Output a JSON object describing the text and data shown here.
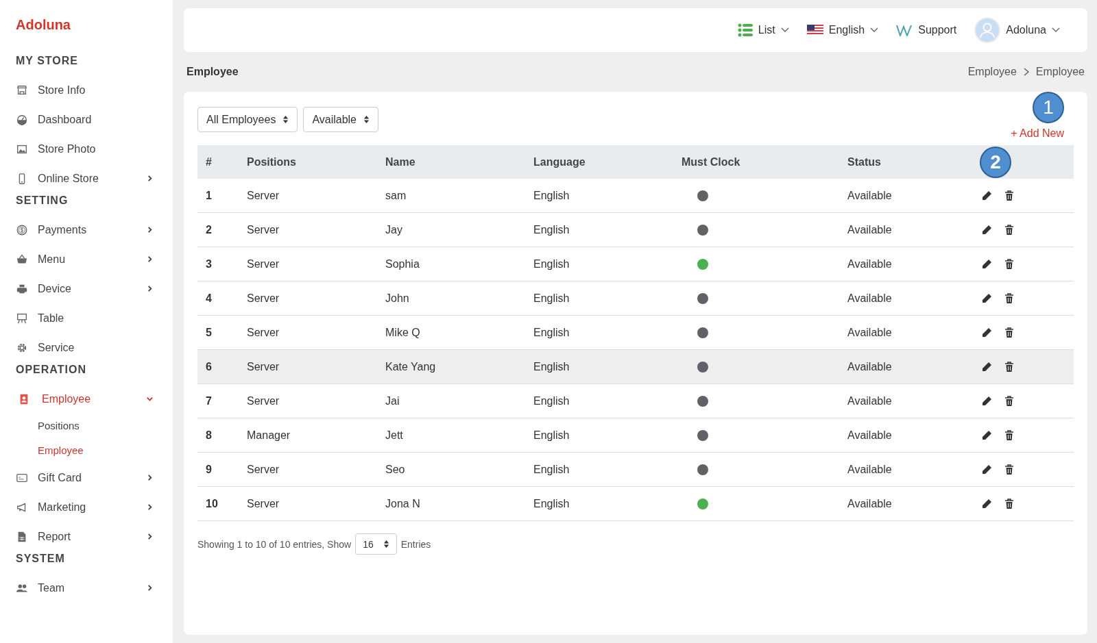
{
  "brand": "Adoluna",
  "sidebar": {
    "sections": [
      {
        "title": "MY STORE",
        "items": [
          {
            "label": "Store Info",
            "selected": false
          },
          {
            "label": "Dashboard",
            "selected": false
          },
          {
            "label": "Store Photo",
            "selected": false
          },
          {
            "label": "Online Store",
            "selected": false,
            "expanded": false
          }
        ]
      },
      {
        "title": "SETTING",
        "items": [
          {
            "label": "Payments",
            "selected": false,
            "expanded": false
          },
          {
            "label": "Menu",
            "selected": false,
            "expanded": false
          },
          {
            "label": "Device",
            "selected": false,
            "expanded": false
          },
          {
            "label": "Table",
            "selected": false
          },
          {
            "label": "Service",
            "selected": false
          }
        ]
      },
      {
        "title": "OPERATION",
        "items": [
          {
            "label": "Employee",
            "selected": true,
            "expanded": true,
            "children": [
              {
                "label": "Positions",
                "selected": false
              },
              {
                "label": "Employee",
                "selected": true
              }
            ]
          },
          {
            "label": "Gift Card",
            "selected": false,
            "expanded": false
          },
          {
            "label": "Marketing",
            "selected": false,
            "expanded": false
          },
          {
            "label": "Report",
            "selected": false,
            "expanded": false
          }
        ]
      },
      {
        "title": "SYSTEM",
        "items": [
          {
            "label": "Team",
            "selected": false,
            "expanded": false
          }
        ]
      }
    ]
  },
  "topbar": {
    "view": "List",
    "language": "English",
    "support": "Support",
    "user": "Adoluna"
  },
  "page_title": "Employee",
  "breadcrumb": [
    "Employee",
    "Employee"
  ],
  "filters": [
    {
      "value": "All Employees"
    },
    {
      "value": "Available"
    }
  ],
  "add_button": "+ Add New",
  "callouts": [
    "1",
    "2"
  ],
  "table": {
    "columns": [
      "#",
      "Positions",
      "Name",
      "Language",
      "Must Clock",
      "Status"
    ],
    "rows": [
      {
        "no": "1",
        "position": "Server",
        "name": "sam",
        "language": "English",
        "must_clock": false,
        "status": "Available",
        "selected": false
      },
      {
        "no": "2",
        "position": "Server",
        "name": "Jay",
        "language": "English",
        "must_clock": false,
        "status": "Available",
        "selected": false
      },
      {
        "no": "3",
        "position": "Server",
        "name": "Sophia",
        "language": "English",
        "must_clock": true,
        "status": "Available",
        "selected": false
      },
      {
        "no": "4",
        "position": "Server",
        "name": "John",
        "language": "English",
        "must_clock": false,
        "status": "Available",
        "selected": false
      },
      {
        "no": "5",
        "position": "Server",
        "name": "Mike Q",
        "language": "English",
        "must_clock": false,
        "status": "Available",
        "selected": false
      },
      {
        "no": "6",
        "position": "Server",
        "name": "Kate Yang",
        "language": "English",
        "must_clock": false,
        "status": "Available",
        "selected": true
      },
      {
        "no": "7",
        "position": "Server",
        "name": "Jai",
        "language": "English",
        "must_clock": false,
        "status": "Available",
        "selected": false
      },
      {
        "no": "8",
        "position": "Manager",
        "name": "Jett",
        "language": "English",
        "must_clock": false,
        "status": "Available",
        "selected": false
      },
      {
        "no": "9",
        "position": "Server",
        "name": "Seo",
        "language": "English",
        "must_clock": false,
        "status": "Available",
        "selected": false
      },
      {
        "no": "10",
        "position": "Server",
        "name": "Jona N",
        "language": "English",
        "must_clock": true,
        "status": "Available",
        "selected": false
      }
    ]
  },
  "footer": {
    "summary": "Showing 1 to 10 of 10 entries, Show",
    "page_size": "16",
    "suffix": "Entries"
  }
}
